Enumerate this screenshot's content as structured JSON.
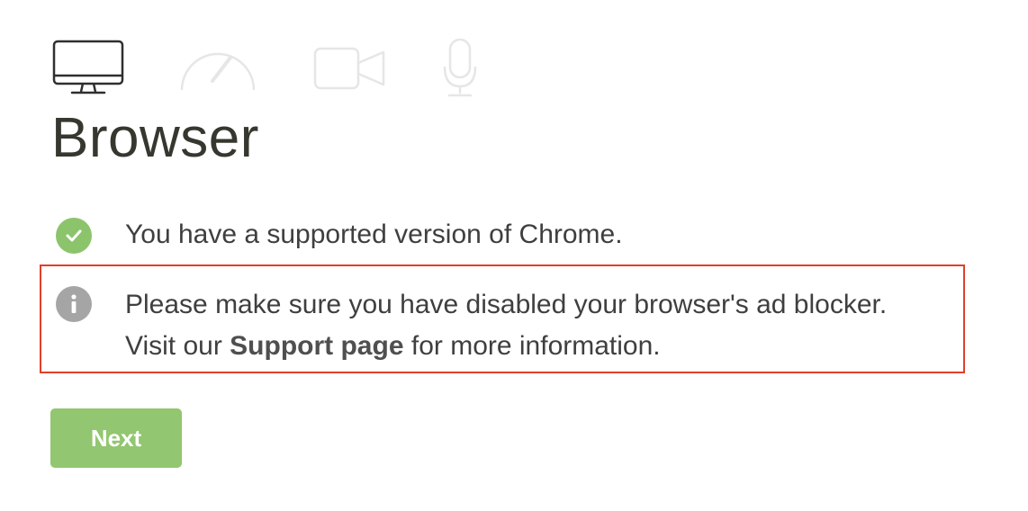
{
  "header": {
    "steps": [
      {
        "icon": "monitor-icon",
        "active": true
      },
      {
        "icon": "speedometer-icon",
        "active": false
      },
      {
        "icon": "video-camera-icon",
        "active": false
      },
      {
        "icon": "microphone-icon",
        "active": false
      }
    ],
    "title": "Browser"
  },
  "checks": {
    "supported": {
      "icon": "checkmark-icon",
      "text": "You have a supported version of Chrome."
    },
    "adblock": {
      "icon": "info-icon",
      "line1": "Please make sure you have disabled your browser's ad blocker.",
      "line2_prefix": "Visit our",
      "link_text": "Support page",
      "line2_suffix": "for more information."
    }
  },
  "actions": {
    "next_label": "Next"
  },
  "colors": {
    "accent_green": "#92c670",
    "check_green": "#8cc46c",
    "info_gray": "#a5a5a5",
    "highlight_red": "#e0402b",
    "inactive_icon": "#e6e6e6",
    "active_icon": "#2f2f2f"
  }
}
